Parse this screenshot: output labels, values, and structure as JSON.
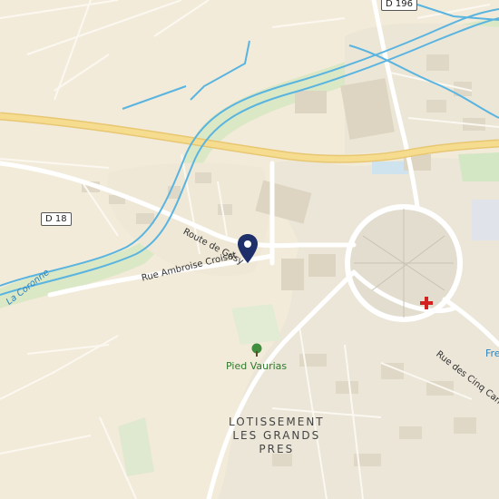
{
  "map": {
    "pin": {
      "icon": "location-pin-icon",
      "color": "#1e2f6a"
    },
    "labels": {
      "route_de_grisy": "Route de Grisy",
      "rue_ambroise_croisat": "Rue Ambroise Croisat",
      "la_coronne": "La Coronne",
      "pied_vaurias": "Pied Vaurias",
      "rue_des_cinq_canons": "Rue des Cinq Canons",
      "fre": "Fre",
      "lotissement_line1": "LOTISSEMENT",
      "lotissement_line2": "LES GRANDS",
      "lotissement_line3": "PRES"
    },
    "road_shields": {
      "d196": "D 196",
      "d18": "D 18"
    },
    "poi": {
      "tree_icon": "tree-icon",
      "cross_icon": "red-cross-icon"
    },
    "colors": {
      "background": "#f3ebd9",
      "highway": "#f2d98a",
      "road": "#ffffff",
      "water": "#5ab4e0",
      "park": "#d4e7c4",
      "urban": "#e9e4d6",
      "building": "#ddd5c4",
      "cross": "#d32020",
      "water_label": "#2b83bf",
      "poi_label": "#2f7a2f"
    }
  }
}
